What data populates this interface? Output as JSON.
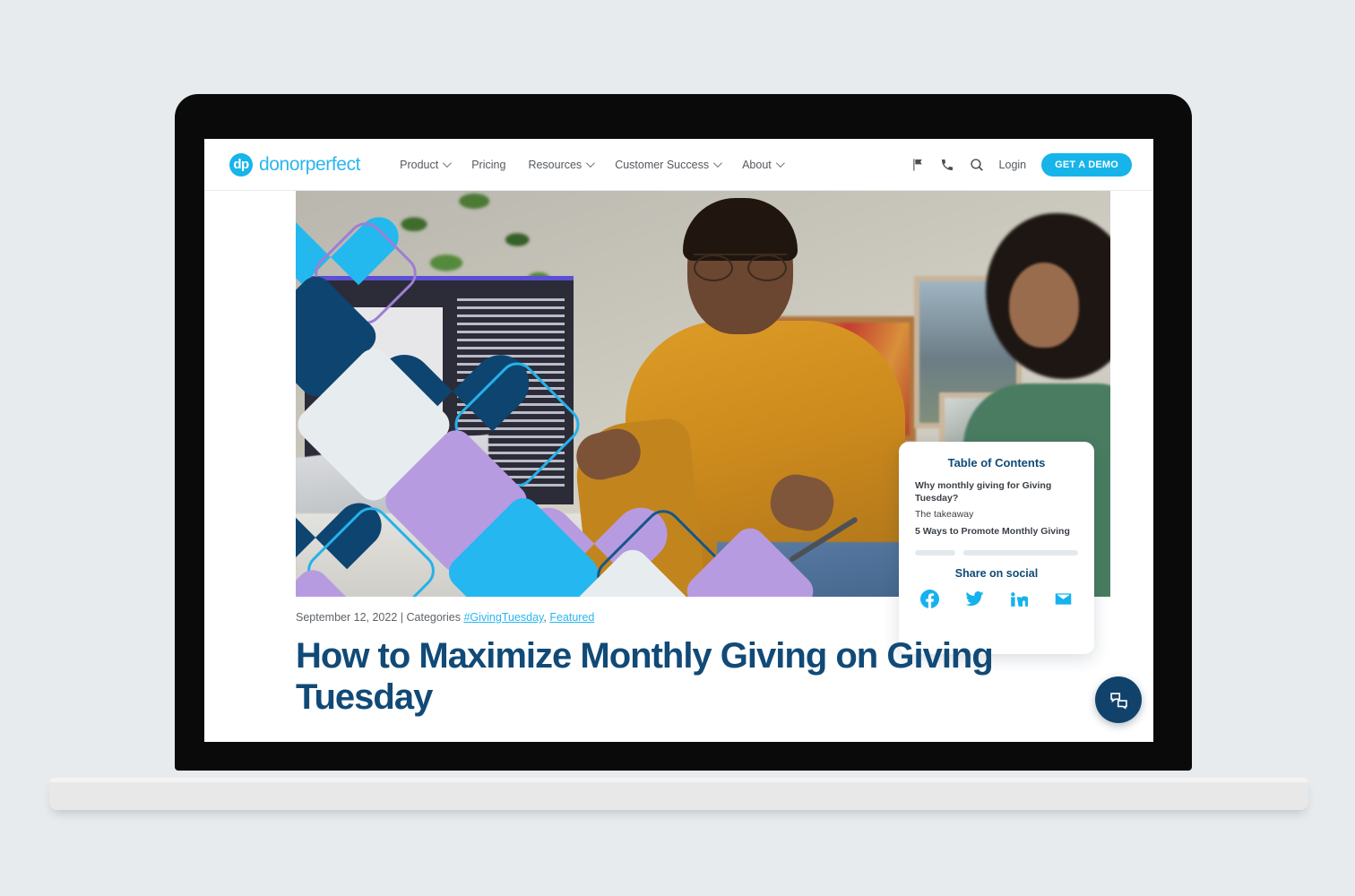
{
  "brand": {
    "logo_mark": "dp",
    "logo_word": "donorperfect",
    "accent_cyan": "#17b4ea",
    "accent_navy": "#114a77",
    "accent_purple": "#b79be0"
  },
  "nav": {
    "links": [
      {
        "label": "Product",
        "has_caret": true
      },
      {
        "label": "Pricing",
        "has_caret": false
      },
      {
        "label": "Resources",
        "has_caret": true
      },
      {
        "label": "Customer Success",
        "has_caret": true
      },
      {
        "label": "About",
        "has_caret": true
      }
    ],
    "icons": [
      "flag-icon",
      "phone-icon",
      "search-icon"
    ],
    "login_label": "Login",
    "demo_label": "GET A DEMO"
  },
  "toc": {
    "title": "Table of Contents",
    "items": [
      {
        "label": "Why monthly giving for Giving Tuesday?",
        "bold": true
      },
      {
        "label": "The takeaway",
        "bold": false
      },
      {
        "label": "5 Ways to Promote Monthly Giving",
        "bold": true
      }
    ],
    "share_title": "Share on social",
    "social": [
      "facebook-icon",
      "twitter-icon",
      "linkedin-icon",
      "email-icon"
    ]
  },
  "article": {
    "date": "September 12, 2022",
    "separator": "|",
    "categories_label": "Categories",
    "categories": [
      {
        "label": "#GivingTuesday"
      },
      {
        "label": "Featured"
      }
    ],
    "categories_comma": ",",
    "headline": "How to Maximize Monthly Giving on Giving Tuesday"
  },
  "widgets": {
    "chat_icon": "chat-bubbles-icon"
  }
}
